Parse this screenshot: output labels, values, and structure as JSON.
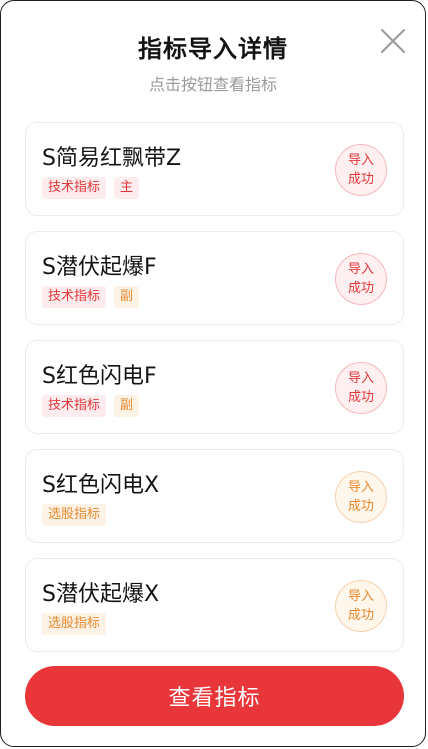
{
  "modal": {
    "title": "指标导入详情",
    "subtitle": "点击按钮查看指标"
  },
  "close_icon": "close-icon",
  "indicators": [
    {
      "name": "S简易红飘带Z",
      "tags": [
        {
          "text": "技术指标",
          "tone": "red"
        },
        {
          "text": "主",
          "tone": "red"
        }
      ],
      "status_line1": "导入",
      "status_line2": "成功",
      "status_tone": "red"
    },
    {
      "name": "S潜伏起爆F",
      "tags": [
        {
          "text": "技术指标",
          "tone": "red"
        },
        {
          "text": "副",
          "tone": "orange"
        }
      ],
      "status_line1": "导入",
      "status_line2": "成功",
      "status_tone": "red"
    },
    {
      "name": "S红色闪电F",
      "tags": [
        {
          "text": "技术指标",
          "tone": "red"
        },
        {
          "text": "副",
          "tone": "orange"
        }
      ],
      "status_line1": "导入",
      "status_line2": "成功",
      "status_tone": "red"
    },
    {
      "name": "S红色闪电X",
      "tags": [
        {
          "text": "选股指标",
          "tone": "orange"
        }
      ],
      "status_line1": "导入",
      "status_line2": "成功",
      "status_tone": "orange"
    },
    {
      "name": "S潜伏起爆X",
      "tags": [
        {
          "text": "选股指标",
          "tone": "orange"
        }
      ],
      "status_line1": "导入",
      "status_line2": "成功",
      "status_tone": "orange"
    }
  ],
  "primary_button": {
    "label": "查看指标"
  },
  "colors": {
    "accent_red": "#e8363b",
    "accent_orange": "#e8892d",
    "subtitle_gray": "#9b9b9b"
  }
}
